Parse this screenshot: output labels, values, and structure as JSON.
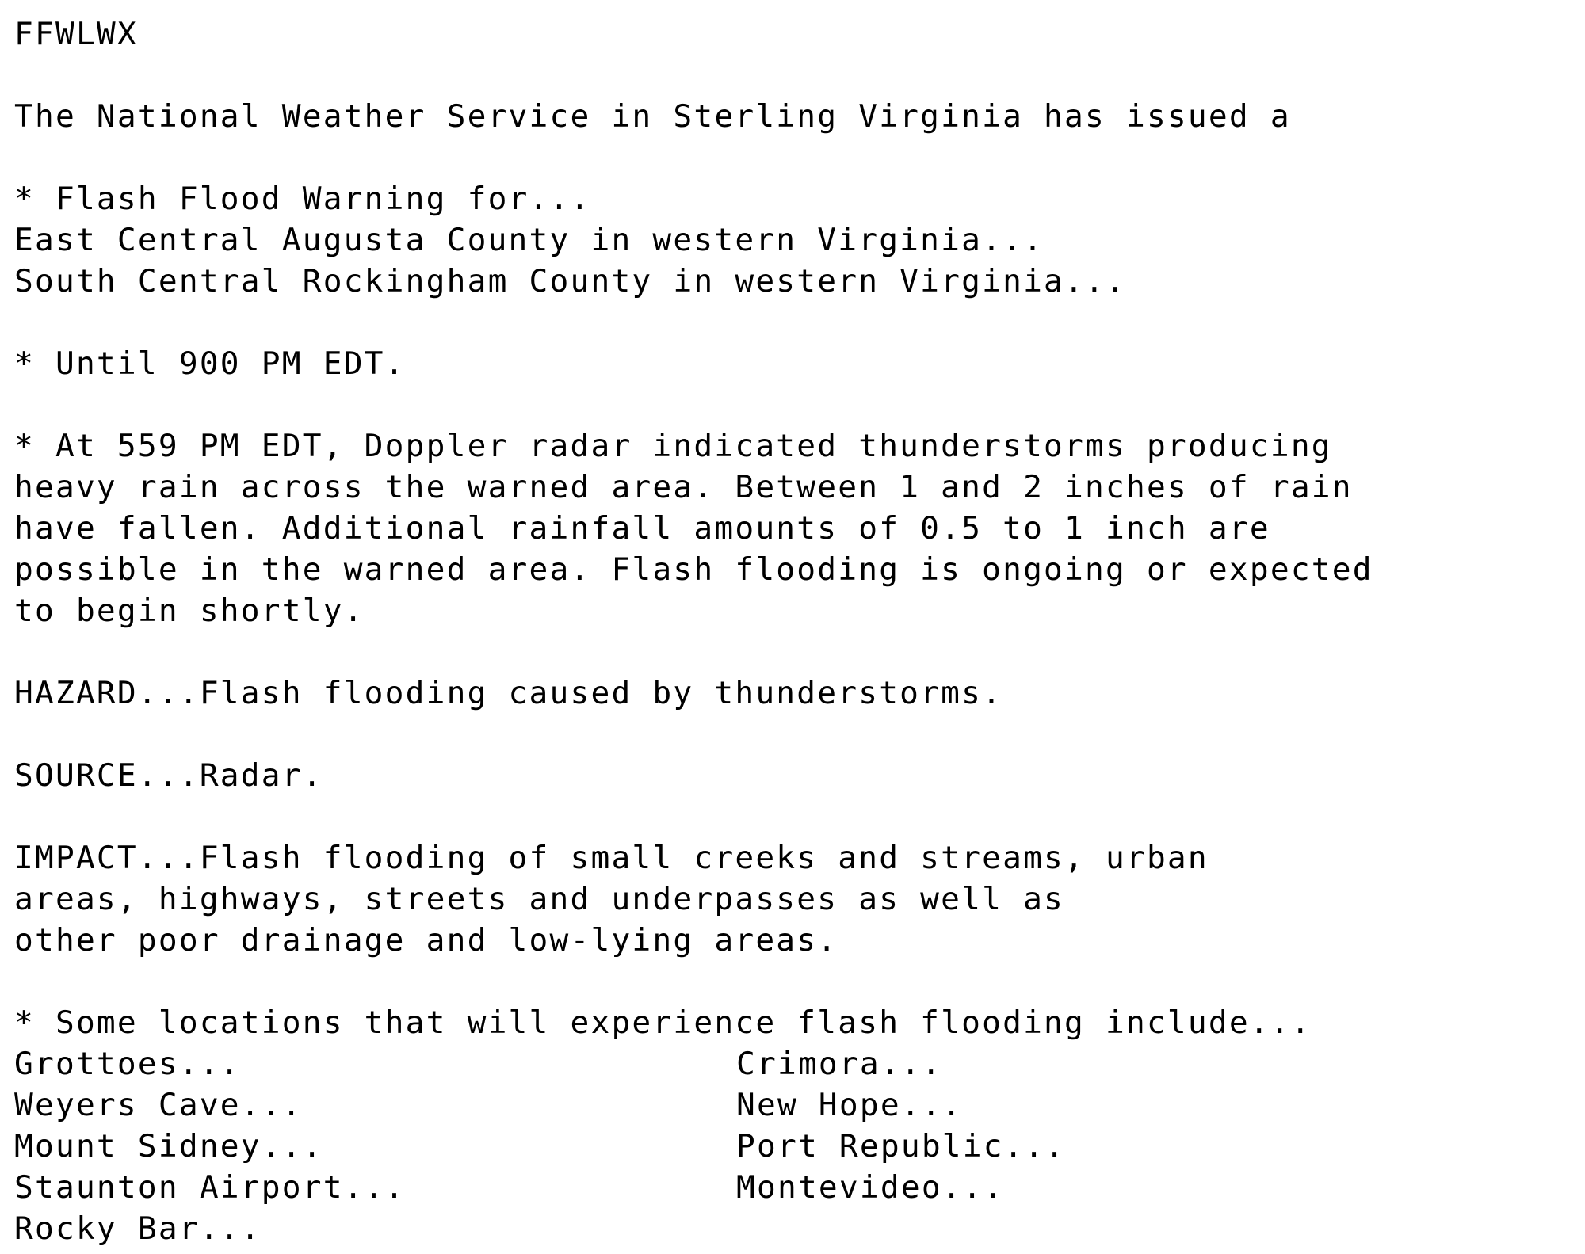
{
  "product_id": "FFWLWX",
  "intro": "The National Weather Service in Sterling Virginia has issued a",
  "warning": {
    "header": "* Flash Flood Warning for...",
    "areas": [
      "East Central Augusta County in western Virginia...",
      "South Central Rockingham County in western Virginia..."
    ]
  },
  "until": "* Until 900 PM EDT.",
  "details": [
    "* At 559 PM EDT, Doppler radar indicated thunderstorms producing",
    "heavy rain across the warned area. Between 1 and 2 inches of rain",
    "have fallen. Additional rainfall amounts of 0.5 to 1 inch are",
    "possible in the warned area. Flash flooding is ongoing or expected",
    "to begin shortly."
  ],
  "hazard": "HAZARD...Flash flooding caused by thunderstorms.",
  "source": "SOURCE...Radar.",
  "impact": [
    "IMPACT...Flash flooding of small creeks and streams, urban",
    "areas, highways, streets and underpasses as well as",
    "other poor drainage and low-lying areas."
  ],
  "locations": {
    "header": "* Some locations that will experience flash flooding include...",
    "rows": [
      [
        "Grottoes...",
        "Crimora..."
      ],
      [
        "Weyers Cave...",
        "New Hope..."
      ],
      [
        "Mount Sidney...",
        "Port Republic..."
      ],
      [
        "Staunton Airport...",
        "Montevideo..."
      ],
      [
        "Rocky Bar...",
        ""
      ]
    ]
  }
}
